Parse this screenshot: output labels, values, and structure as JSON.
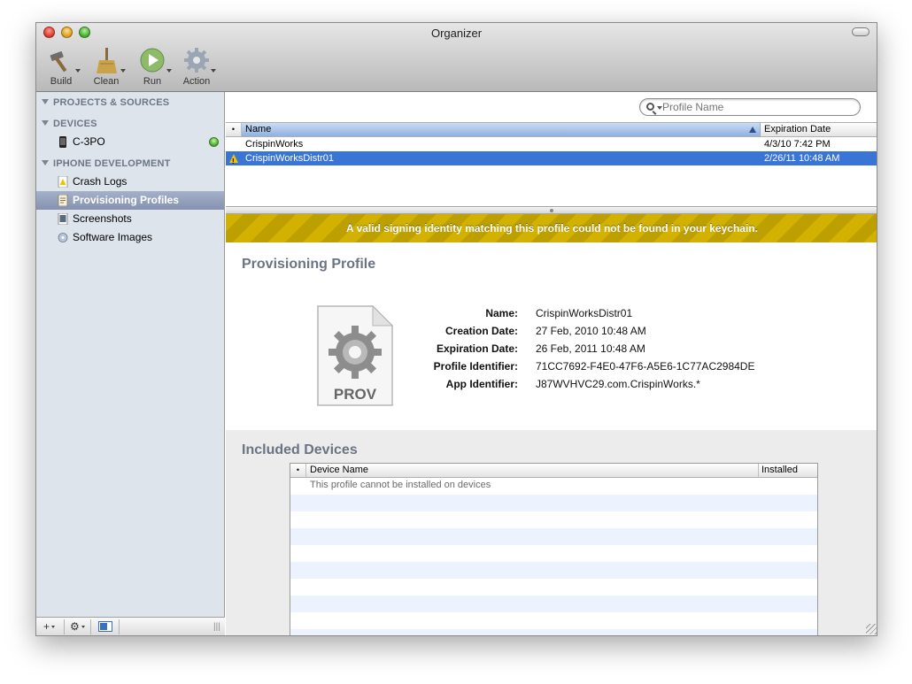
{
  "window": {
    "title": "Organizer"
  },
  "toolbar": {
    "build_label": "Build",
    "clean_label": "Clean",
    "run_label": "Run",
    "action_label": "Action"
  },
  "sidebar": {
    "groups": {
      "projects": "PROJECTS & SOURCES",
      "devices": "DEVICES",
      "iphone": "IPHONE DEVELOPMENT"
    },
    "device_item": {
      "label": "C-3PO",
      "status_color": "#3ea82a"
    },
    "items": [
      {
        "label": "Crash Logs"
      },
      {
        "label": "Provisioning Profiles",
        "selected": true
      },
      {
        "label": "Screenshots"
      },
      {
        "label": "Software Images"
      }
    ],
    "bottom": {
      "add": "+",
      "gear": "⚙"
    }
  },
  "search": {
    "placeholder": "Profile Name"
  },
  "profiles_table": {
    "dot_header": "•",
    "name_header": "Name",
    "expiration_header": "Expiration Date",
    "rows": [
      {
        "name": "CrispinWorks",
        "expiration": "4/3/10 7:42 PM",
        "warning": false
      },
      {
        "name": "CrispinWorksDistr01",
        "expiration": "2/26/11 10:48 AM",
        "warning": true,
        "selected": true
      }
    ]
  },
  "banner": {
    "text": "A valid signing identity matching this profile could not be found in your keychain.",
    "color": "#d2b100"
  },
  "profile": {
    "section_title": "Provisioning Profile",
    "icon_label": "PROV",
    "fields": [
      {
        "label": "Name:",
        "value": "CrispinWorksDistr01"
      },
      {
        "label": "Creation Date:",
        "value": "27 Feb, 2010 10:48 AM"
      },
      {
        "label": "Expiration Date:",
        "value": "26 Feb, 2011 10:48 AM"
      },
      {
        "label": "Profile Identifier:",
        "value": "71CC7692-F4E0-47F6-A5E6-1C77AC2984DE"
      },
      {
        "label": "App Identifier:",
        "value": "J87WVHVC29.com.CrispinWorks.*"
      }
    ]
  },
  "devices": {
    "section_title": "Included Devices",
    "dot_header": "•",
    "name_header": "Device Name",
    "installed_header": "Installed",
    "empty_message": "This profile cannot be installed on devices"
  },
  "colors": {
    "selection": "#3875d7",
    "sidebar_bg": "#dde4ec",
    "section_title": "#6a7482"
  }
}
